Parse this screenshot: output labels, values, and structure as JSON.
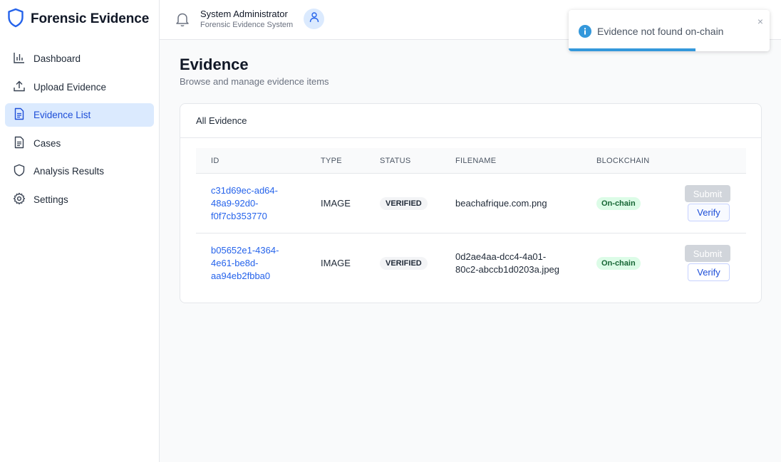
{
  "app": {
    "title": "Forensic Evidence"
  },
  "sidebar": {
    "items": [
      {
        "label": "Dashboard",
        "icon": "bar-chart-icon",
        "active": false
      },
      {
        "label": "Upload Evidence",
        "icon": "upload-icon",
        "active": false
      },
      {
        "label": "Evidence List",
        "icon": "document-icon",
        "active": true
      },
      {
        "label": "Cases",
        "icon": "document-icon",
        "active": false
      },
      {
        "label": "Analysis Results",
        "icon": "shield-icon",
        "active": false
      },
      {
        "label": "Settings",
        "icon": "gear-icon",
        "active": false
      }
    ]
  },
  "header": {
    "user_name": "System Administrator",
    "user_subtitle": "Forensic Evidence System"
  },
  "page": {
    "title": "Evidence",
    "subtitle": "Browse and manage evidence items"
  },
  "card": {
    "title": "All Evidence",
    "columns": [
      "ID",
      "TYPE",
      "STATUS",
      "FILENAME",
      "BLOCKCHAIN"
    ],
    "rows": [
      {
        "id": "c31d69ec-ad64-48a9-92d0-f0f7cb353770",
        "id_lines": [
          "c31d69ec-ad64-",
          "48a9-92d0-",
          "f0f7cb353770"
        ],
        "type": "IMAGE",
        "status": "VERIFIED",
        "filename_lines": [
          "beachafrique.com.png"
        ],
        "blockchain": "On-chain",
        "submit_label": "Submit",
        "verify_label": "Verify"
      },
      {
        "id": "b05652e1-4364-4e61-be8d-aa94eb2fbba0",
        "id_lines": [
          "b05652e1-4364-",
          "4e61-be8d-",
          "aa94eb2fbba0"
        ],
        "type": "IMAGE",
        "status": "VERIFIED",
        "filename_lines": [
          "0d2ae4aa-dcc4-4a01-",
          "80c2-abccb1d0203a.jpeg"
        ],
        "blockchain": "On-chain",
        "submit_label": "Submit",
        "verify_label": "Verify"
      }
    ]
  },
  "toast": {
    "message": "Evidence not found on-chain",
    "close_glyph": "×",
    "progress": 0.63
  },
  "colors": {
    "accent": "#2563eb",
    "active_nav_bg": "#dbeafe",
    "chain_badge_bg": "#dcfce7",
    "chain_badge_text": "#166534",
    "toast_progress": "#3498db"
  }
}
